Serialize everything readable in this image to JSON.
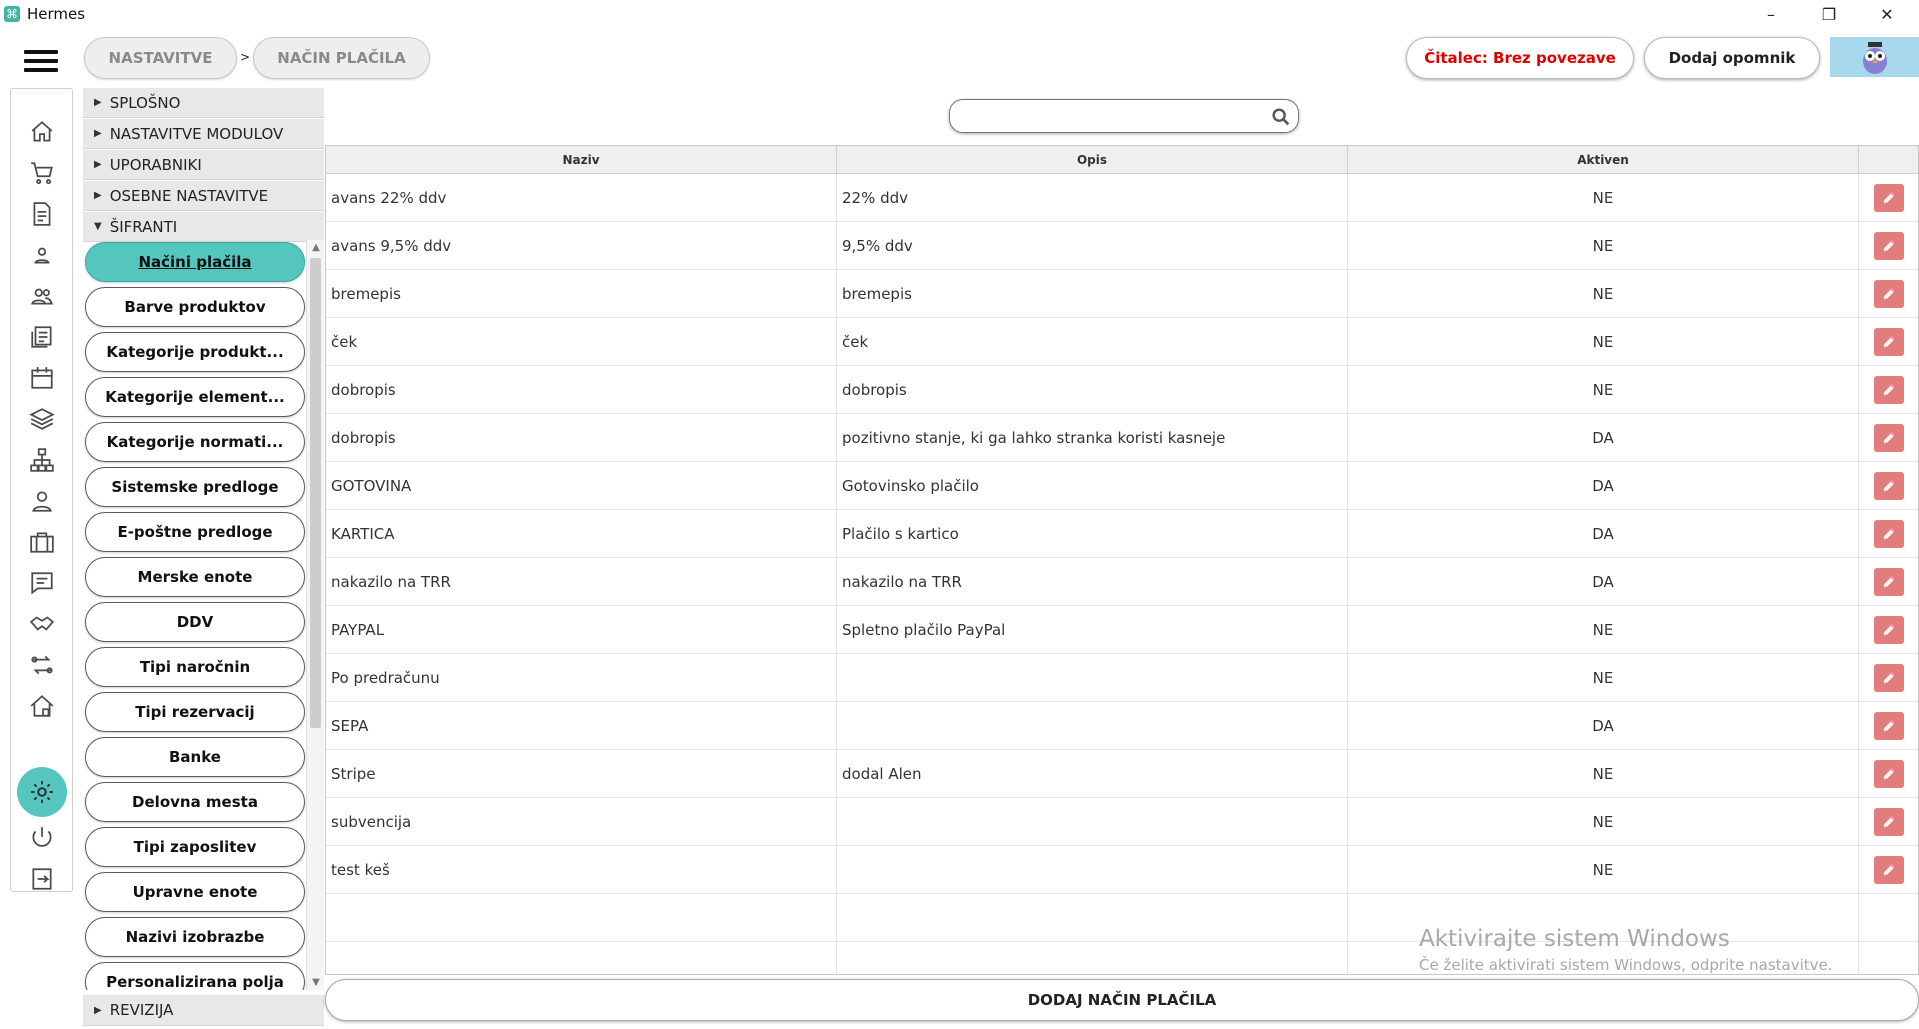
{
  "app": {
    "title": "Hermes"
  },
  "breadcrumb": [
    "NASTAVITVE",
    "NAČIN PLAČILA"
  ],
  "breadcrumb_sep": ">",
  "header": {
    "reader_status": "Čitalec: Brez povezave",
    "add_reminder": "Dodaj opomnik"
  },
  "nav_icons": [
    "home-icon",
    "cart-icon",
    "document-icon",
    "person-icon",
    "people-icon",
    "list-icon",
    "calendar-icon",
    "layers-icon",
    "network-icon",
    "user-badge-icon",
    "briefcase-icon",
    "chat-icon",
    "handshake-icon",
    "transfer-icon",
    "house-icon",
    "settings-icon",
    "power-icon",
    "logout-icon"
  ],
  "tree": {
    "sections_top": [
      "SPLOŠNO",
      "NASTAVITVE MODULOV",
      "UPORABNIKI",
      "OSEBNE NASTAVITVE",
      "ŠIFRANTI"
    ],
    "items": [
      "Načini plačila",
      "Barve produktov",
      "Kategorije produkt...",
      "Kategorije element...",
      "Kategorije normati...",
      "Sistemske predloge",
      "E-poštne predloge",
      "Merske enote",
      "DDV",
      "Tipi naročnin",
      "Tipi rezervacij",
      "Banke",
      "Delovna mesta",
      "Tipi zaposlitev",
      "Upravne enote",
      "Nazivi izobrazbe",
      "Personalizirana polja"
    ],
    "active_item": "Načini plačila",
    "section_bottom": "REVIZIJA"
  },
  "search": {
    "placeholder": ""
  },
  "table": {
    "columns": [
      "Naziv",
      "Opis",
      "Aktiven",
      ""
    ],
    "rows": [
      [
        "avans 22% ddv",
        "22% ddv",
        "NE"
      ],
      [
        "avans 9,5% ddv",
        "9,5% ddv",
        "NE"
      ],
      [
        "bremepis",
        "bremepis",
        "NE"
      ],
      [
        "ček",
        "ček",
        "NE"
      ],
      [
        "dobropis",
        "dobropis",
        "NE"
      ],
      [
        "dobropis",
        "pozitivno stanje, ki ga lahko stranka koristi kasneje",
        "DA"
      ],
      [
        "GOTOVINA",
        "Gotovinsko plačilo",
        "DA"
      ],
      [
        "KARTICA",
        "Plačilo s kartico",
        "DA"
      ],
      [
        "nakazilo na TRR",
        "nakazilo na TRR",
        "DA"
      ],
      [
        "PAYPAL",
        "Spletno plačilo PayPal",
        "NE"
      ],
      [
        "Po predračunu",
        "",
        "NE"
      ],
      [
        "SEPA",
        "",
        "DA"
      ],
      [
        "Stripe",
        "dodal Alen",
        "NE"
      ],
      [
        "subvencija",
        "",
        "NE"
      ],
      [
        "test keš",
        "",
        "NE"
      ]
    ]
  },
  "add_button": "DODAJ NAČIN PLAČILA",
  "watermark": {
    "title": "Aktivirajte sistem Windows",
    "subtitle": "Če želite aktivirati sistem Windows, odprite nastavitve."
  },
  "colors": {
    "accent": "#55c6bd",
    "edit": "#e57c7c",
    "reader_status": "#e00000"
  }
}
